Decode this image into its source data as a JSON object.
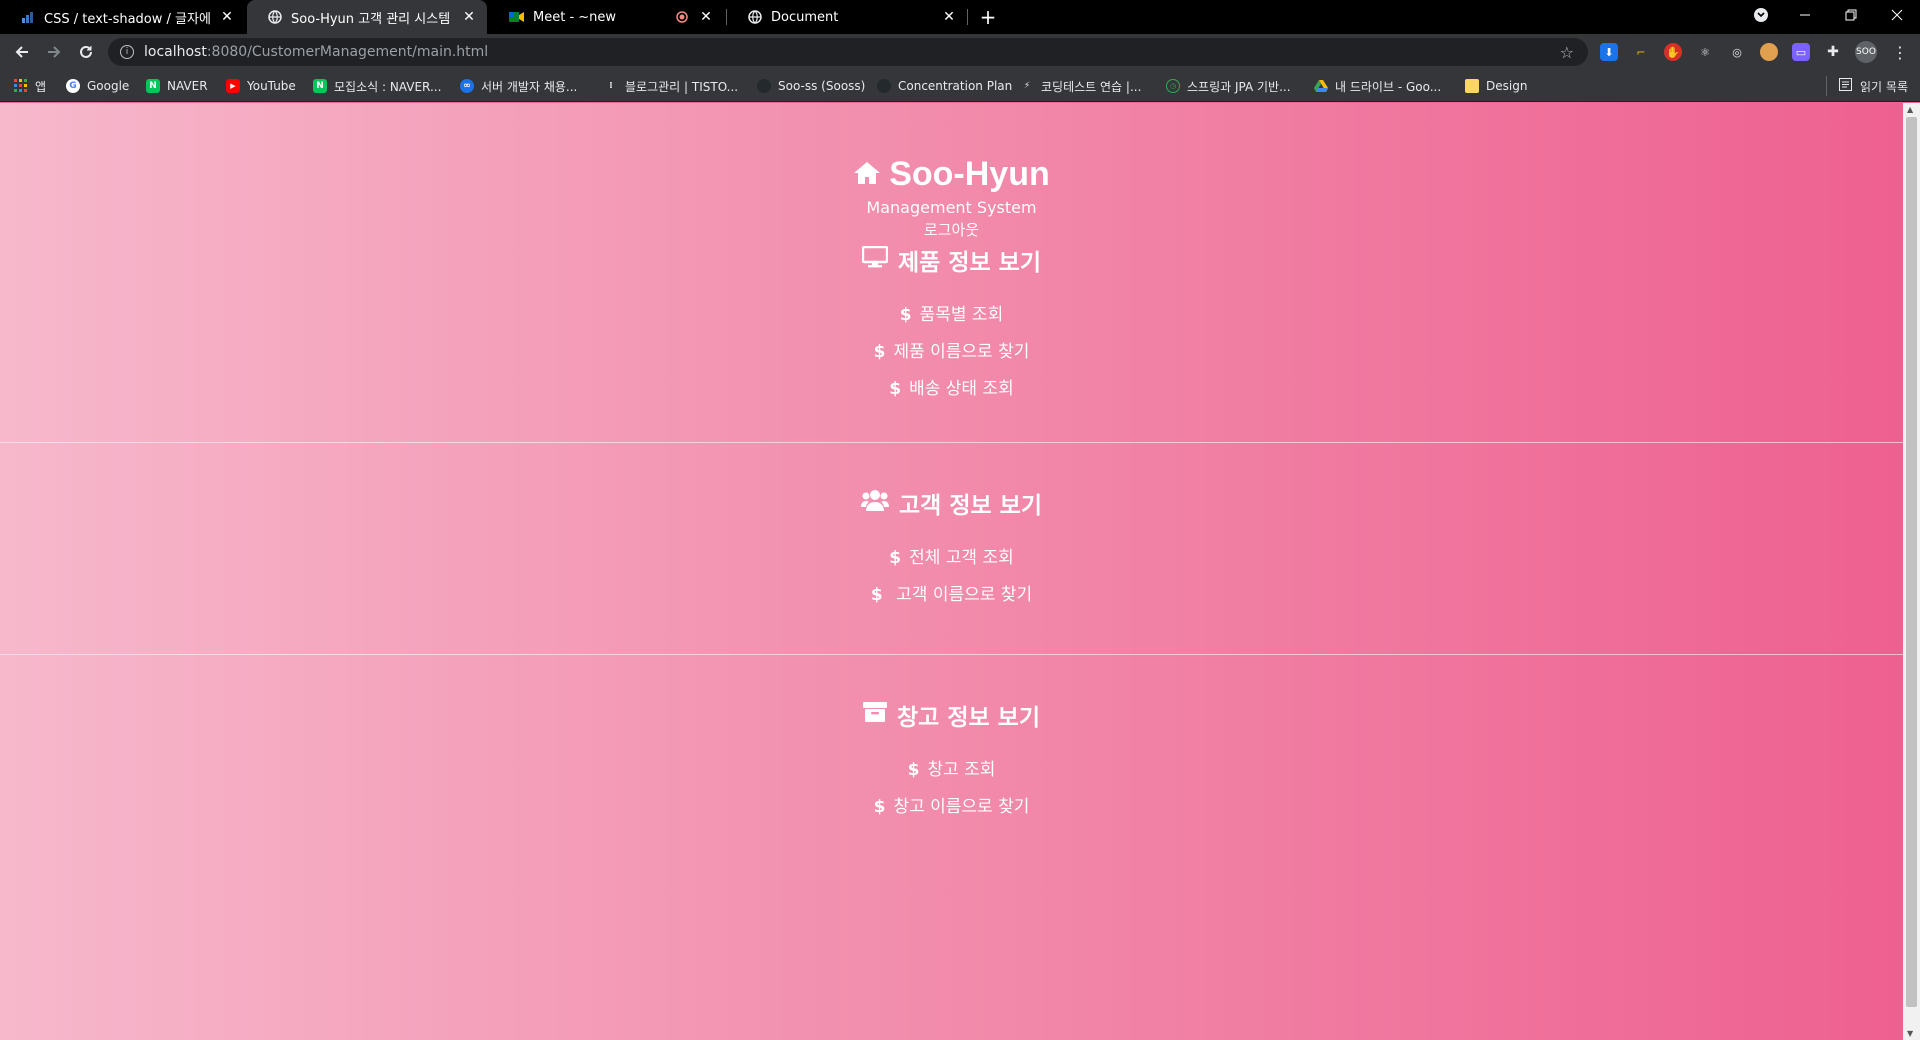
{
  "tabs": [
    {
      "title": "CSS / text-shadow / 글자에 그림자",
      "favicon": "tistory-icon"
    },
    {
      "title": "Soo-Hyun 고객 관리 시스템",
      "favicon": "globe-icon"
    },
    {
      "title": "Meet - ~new",
      "favicon": "meet-icon"
    },
    {
      "title": "Document",
      "favicon": "globe-icon"
    }
  ],
  "toolbar": {
    "url_host": "localhost",
    "url_rest": ":8080/CustomerManagement/main.html",
    "profile": "SOO"
  },
  "bookmarks": {
    "items": [
      "앱",
      "Google",
      "NAVER",
      "YouTube",
      "모집소식 : NAVER...",
      "서버 개발자 채용...",
      "블로그관리 | TISTO...",
      "Soo-ss (Sooss)",
      "Concentration Plan",
      "코딩테스트 연습 |...",
      "스프링과 JPA 기반...",
      "내 드라이브 - Goo...",
      "Design"
    ],
    "reading_list": "읽기 목록"
  },
  "page": {
    "brand": "Soo-Hyun",
    "subtitle": "Management System",
    "logout": "로그아웃",
    "sections": [
      {
        "title": "제품 정보 보기",
        "icon": "monitor-icon",
        "links": [
          "품목별 조회",
          "제품 이름으로 찾기",
          "배송 상태 조회"
        ]
      },
      {
        "title": "고객 정보 보기",
        "icon": "users-icon",
        "links": [
          "전체 고객 조회",
          " 고객 이름으로 찾기"
        ]
      },
      {
        "title": "창고 정보 보기",
        "icon": "archive-icon",
        "links": [
          "창고 조회",
          "창고 이름으로 찾기"
        ]
      }
    ],
    "link_prefix": "$",
    "colors": {
      "gradient_left": "#f7b8cc",
      "gradient_right": "#ee6090"
    }
  }
}
